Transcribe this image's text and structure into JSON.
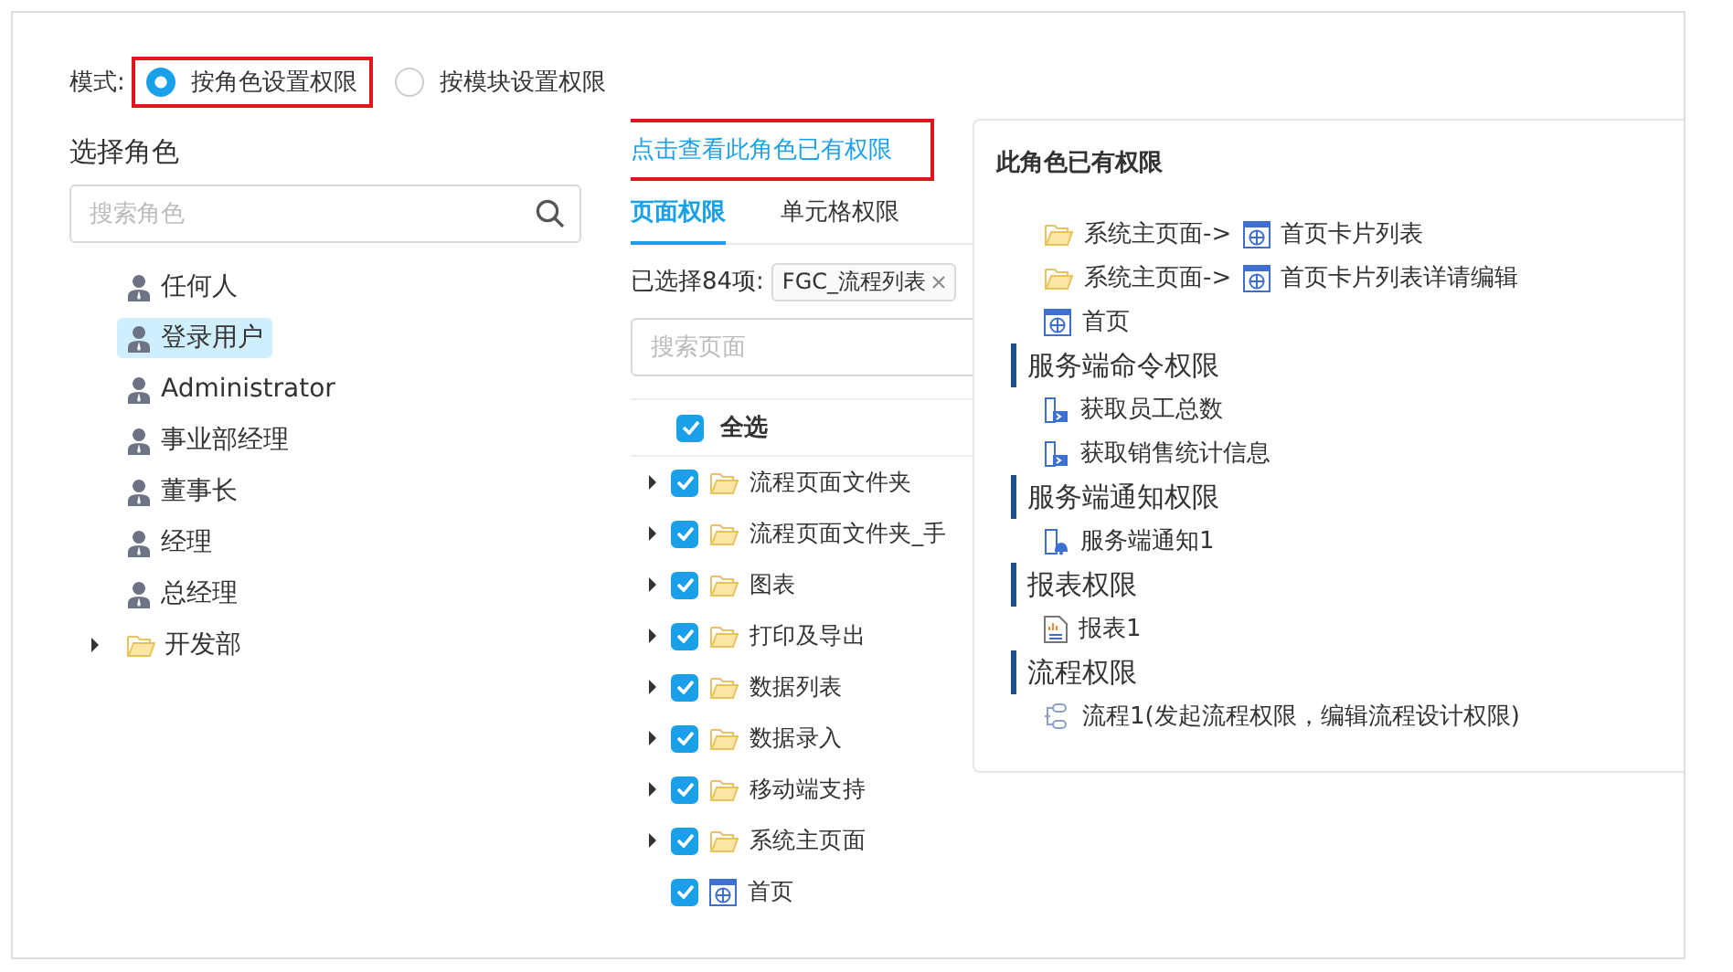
{
  "mode": {
    "label": "模式:",
    "options": [
      {
        "label": "按角色设置权限",
        "selected": true,
        "highlighted": true
      },
      {
        "label": "按模块设置权限",
        "selected": false,
        "highlighted": false
      }
    ]
  },
  "roles": {
    "title": "选择角色",
    "search": {
      "placeholder": "搜索角色"
    },
    "items": [
      {
        "label": "任何人",
        "kind": "user",
        "selected": false
      },
      {
        "label": "登录用户",
        "kind": "user",
        "selected": true
      },
      {
        "label": "Administrator",
        "kind": "user",
        "selected": false
      },
      {
        "label": "事业部经理",
        "kind": "user",
        "selected": false
      },
      {
        "label": "董事长",
        "kind": "user",
        "selected": false
      },
      {
        "label": "经理",
        "kind": "user",
        "selected": false
      },
      {
        "label": "总经理",
        "kind": "user",
        "selected": false
      },
      {
        "label": "开发部",
        "kind": "folder",
        "selected": false
      }
    ]
  },
  "permissions": {
    "link": {
      "label": "点击查看此角色已有权限",
      "highlighted": true
    },
    "tabs": [
      {
        "label": "页面权限",
        "selected": true
      },
      {
        "label": "单元格权限",
        "selected": false
      }
    ],
    "selected_summary": "已选择84项:",
    "tags": [
      {
        "label": "FGC_流程列表"
      }
    ],
    "search": {
      "placeholder": "搜索页面"
    },
    "select_all": {
      "label": "全选",
      "checked": true
    },
    "pages": [
      {
        "label": "流程页面文件夹",
        "kind": "folder",
        "checked": true
      },
      {
        "label": "流程页面文件夹_手",
        "kind": "folder",
        "checked": true
      },
      {
        "label": "图表",
        "kind": "folder",
        "checked": true
      },
      {
        "label": "打印及导出",
        "kind": "folder",
        "checked": true
      },
      {
        "label": "数据列表",
        "kind": "folder",
        "checked": true
      },
      {
        "label": "数据录入",
        "kind": "folder",
        "checked": true
      },
      {
        "label": "移动端支持",
        "kind": "folder",
        "checked": true
      },
      {
        "label": "系统主页面",
        "kind": "folder",
        "checked": true
      },
      {
        "label": "首页",
        "kind": "page",
        "checked": true
      }
    ]
  },
  "popover": {
    "title": "此角色已有权限",
    "sections": [
      {
        "items": [
          {
            "kind": "page-path",
            "folder": "系统主页面->",
            "label": "首页卡片列表"
          },
          {
            "kind": "page-path",
            "folder": "系统主页面->",
            "label": "首页卡片列表详请编辑"
          },
          {
            "kind": "page",
            "label": "首页"
          }
        ]
      },
      {
        "heading": "服务端命令权限",
        "items": [
          {
            "kind": "command",
            "label": "获取员工总数"
          },
          {
            "kind": "command",
            "label": "获取销售统计信息"
          }
        ]
      },
      {
        "heading": "服务端通知权限",
        "items": [
          {
            "kind": "notification",
            "label": "服务端通知1"
          }
        ]
      },
      {
        "heading": "报表权限",
        "items": [
          {
            "kind": "report",
            "label": "报表1"
          }
        ]
      },
      {
        "heading": "流程权限",
        "items": [
          {
            "kind": "workflow",
            "label": "流程1(发起流程权限，编辑流程设计权限)"
          }
        ]
      }
    ]
  }
}
